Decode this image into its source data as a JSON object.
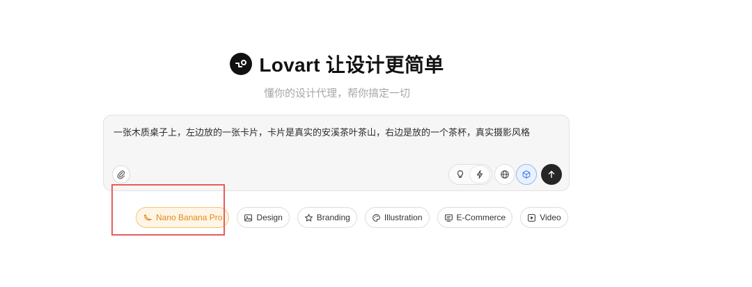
{
  "hero": {
    "title": "Lovart 让设计更简单",
    "subtitle": "懂你的设计代理，帮你搞定一切",
    "logo_icon": "lovart-logo-icon"
  },
  "composer": {
    "prompt": "一张木质桌子上，左边放的一张卡片，卡片是真实的安溪茶叶茶山，右边是放的一个茶杯，真实摄影风格",
    "buttons": {
      "attach": "paperclip-icon",
      "idea_mode": "lightbulb-icon",
      "fast_mode": "lightning-icon",
      "web": "globe-icon",
      "model": "cube-icon",
      "send": "arrow-up-icon"
    }
  },
  "chips": [
    {
      "label": "Nano Banana Pro",
      "icon": "banana-icon"
    },
    {
      "label": "Design",
      "icon": "image-icon"
    },
    {
      "label": "Branding",
      "icon": "star-icon"
    },
    {
      "label": "Illustration",
      "icon": "palette-icon"
    },
    {
      "label": "E-Commerce",
      "icon": "monitor-icon"
    },
    {
      "label": "Video",
      "icon": "play-icon"
    }
  ],
  "colors": {
    "highlight_chip_text": "#e08a14",
    "highlight_chip_bg": "#fff5e6",
    "annotation_box": "#e85a5a",
    "send_button": "#262626"
  }
}
